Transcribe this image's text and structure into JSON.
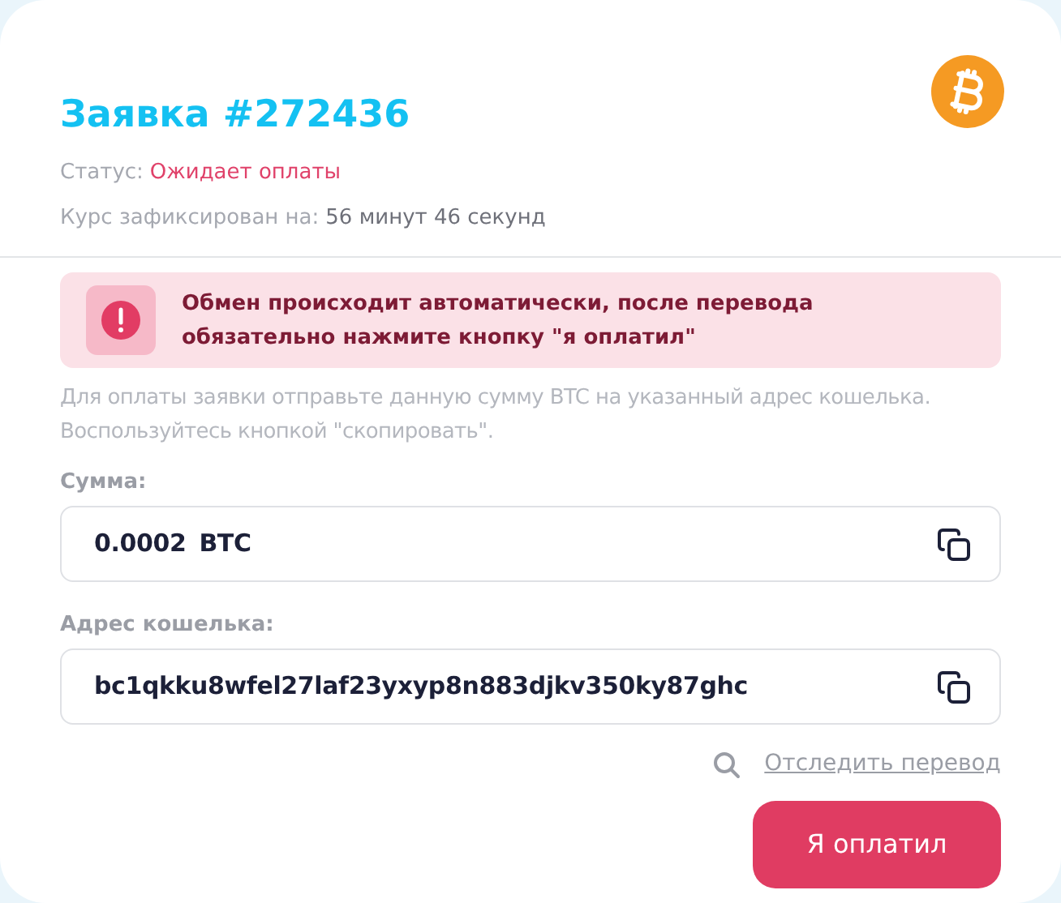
{
  "order": {
    "title": "Заявка #272436",
    "status_label": "Статус:",
    "status_value": "Ожидает оплаты",
    "rate_label": "Курс зафиксирован на:",
    "rate_value": "56 минут 46 секунд"
  },
  "alert": {
    "text": "Обмен происходит автоматически, после перевода обязательно нажмите кнопку \"я оплатил\""
  },
  "instructions": "Для оплаты заявки отправьте данную сумму BTC на указанный адрес кошелька. Воспользуйтесь кнопкой \"скопировать\".",
  "fields": [
    {
      "label": "Сумма:",
      "value": "0.0002",
      "unit": "BTC"
    },
    {
      "label": "Адрес кошелька:",
      "value": "bc1qkku8wfel27laf23yxyp8n883djkv350ky87ghc"
    }
  ],
  "track_link": "Отследить перевод",
  "button": "Я оплатил"
}
